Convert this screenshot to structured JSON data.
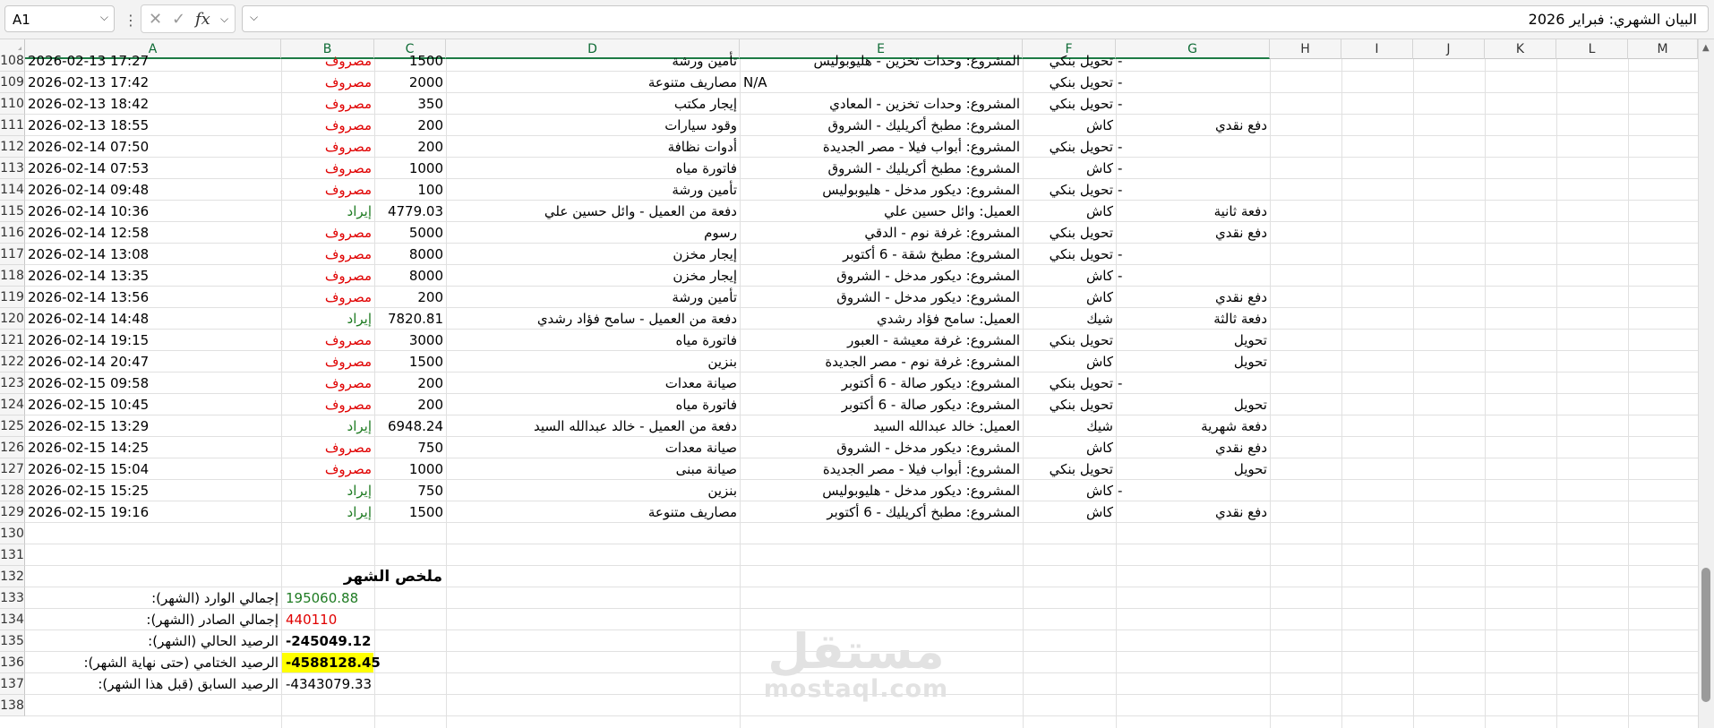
{
  "formula_bar": {
    "name_box": "A1",
    "separator": "⋮",
    "cancel_glyph": "✕",
    "enter_glyph": "✓",
    "fx_glyph": "fx",
    "content": "البيان الشهري: فبراير 2026"
  },
  "columns": [
    "A",
    "B",
    "C",
    "D",
    "E",
    "F",
    "G",
    "H",
    "I",
    "J",
    "K",
    "L",
    "M"
  ],
  "rows": [
    {
      "n": "108",
      "a": "2026-02-13 17:27",
      "b": "مصروف",
      "c": "1500",
      "d": "تأمين ورشة",
      "e": "المشروع: وحدات تخزين - هليوبوليس",
      "f": "تحويل بنكي",
      "g": "-",
      "h": "",
      "bclass": "red"
    },
    {
      "n": "109",
      "a": "2026-02-13 17:42",
      "b": "مصروف",
      "c": "2000",
      "d": "مصاريف متنوعة",
      "e": "N/A",
      "f": "تحويل بنكي",
      "g": "-",
      "h": "",
      "bclass": "red"
    },
    {
      "n": "110",
      "a": "2026-02-13 18:42",
      "b": "مصروف",
      "c": "350",
      "d": "إيجار مكتب",
      "e": "المشروع: وحدات تخزين - المعادي",
      "f": "تحويل بنكي",
      "g": "-",
      "h": "",
      "bclass": "red"
    },
    {
      "n": "111",
      "a": "2026-02-13 18:55",
      "b": "مصروف",
      "c": "200",
      "d": "وقود سيارات",
      "e": "المشروع: مطبخ أكريليك - الشروق",
      "f": "كاش",
      "g": "",
      "h": "دفع نقدي",
      "bclass": "red"
    },
    {
      "n": "112",
      "a": "2026-02-14 07:50",
      "b": "مصروف",
      "c": "200",
      "d": "أدوات نظافة",
      "e": "المشروع: أبواب فيلا - مصر الجديدة",
      "f": "تحويل بنكي",
      "g": "-",
      "h": "",
      "bclass": "red"
    },
    {
      "n": "113",
      "a": "2026-02-14 07:53",
      "b": "مصروف",
      "c": "1000",
      "d": "فاتورة مياه",
      "e": "المشروع: مطبخ أكريليك - الشروق",
      "f": "كاش",
      "g": "-",
      "h": "",
      "bclass": "red"
    },
    {
      "n": "114",
      "a": "2026-02-14 09:48",
      "b": "مصروف",
      "c": "100",
      "d": "تأمين ورشة",
      "e": "المشروع: ديكور مدخل - هليوبوليس",
      "f": "تحويل بنكي",
      "g": "-",
      "h": "",
      "bclass": "red"
    },
    {
      "n": "115",
      "a": "2026-02-14 10:36",
      "b": "إيراد",
      "c": "4779.03",
      "d": "دفعة من العميل - وائل حسين علي",
      "e": "العميل: وائل حسين علي",
      "f": "كاش",
      "g": "",
      "h": "دفعة ثانية",
      "bclass": "green"
    },
    {
      "n": "116",
      "a": "2026-02-14 12:58",
      "b": "مصروف",
      "c": "5000",
      "d": "رسوم",
      "e": "المشروع: غرفة نوم - الدقي",
      "f": "تحويل بنكي",
      "g": "",
      "h": "دفع نقدي",
      "bclass": "red"
    },
    {
      "n": "117",
      "a": "2026-02-14 13:08",
      "b": "مصروف",
      "c": "8000",
      "d": "إيجار مخزن",
      "e": "المشروع: مطبخ شقة - 6 أكتوبر",
      "f": "تحويل بنكي",
      "g": "-",
      "h": "",
      "bclass": "red"
    },
    {
      "n": "118",
      "a": "2026-02-14 13:35",
      "b": "مصروف",
      "c": "8000",
      "d": "إيجار مخزن",
      "e": "المشروع: ديكور مدخل - الشروق",
      "f": "كاش",
      "g": "-",
      "h": "",
      "bclass": "red"
    },
    {
      "n": "119",
      "a": "2026-02-14 13:56",
      "b": "مصروف",
      "c": "200",
      "d": "تأمين ورشة",
      "e": "المشروع: ديكور مدخل - الشروق",
      "f": "كاش",
      "g": "",
      "h": "دفع نقدي",
      "bclass": "red"
    },
    {
      "n": "120",
      "a": "2026-02-14 14:48",
      "b": "إيراد",
      "c": "7820.81",
      "d": "دفعة من العميل - سامح فؤاد رشدي",
      "e": "العميل: سامح فؤاد رشدي",
      "f": "شيك",
      "g": "",
      "h": "دفعة ثالثة",
      "bclass": "green"
    },
    {
      "n": "121",
      "a": "2026-02-14 19:15",
      "b": "مصروف",
      "c": "3000",
      "d": "فاتورة مياه",
      "e": "المشروع: غرفة معيشة - العبور",
      "f": "تحويل بنكي",
      "g": "",
      "h": "تحويل",
      "bclass": "red"
    },
    {
      "n": "122",
      "a": "2026-02-14 20:47",
      "b": "مصروف",
      "c": "1500",
      "d": "بنزين",
      "e": "المشروع: غرفة نوم - مصر الجديدة",
      "f": "كاش",
      "g": "",
      "h": "تحويل",
      "bclass": "red"
    },
    {
      "n": "123",
      "a": "2026-02-15 09:58",
      "b": "مصروف",
      "c": "200",
      "d": "صيانة معدات",
      "e": "المشروع: ديكور صالة - 6 أكتوبر",
      "f": "تحويل بنكي",
      "g": "-",
      "h": "",
      "bclass": "red"
    },
    {
      "n": "124",
      "a": "2026-02-15 10:45",
      "b": "مصروف",
      "c": "200",
      "d": "فاتورة مياه",
      "e": "المشروع: ديكور صالة - 6 أكتوبر",
      "f": "تحويل بنكي",
      "g": "",
      "h": "تحويل",
      "bclass": "red"
    },
    {
      "n": "125",
      "a": "2026-02-15 13:29",
      "b": "إيراد",
      "c": "6948.24",
      "d": "دفعة من العميل - خالد عبدالله السيد",
      "e": "العميل: خالد عبدالله السيد",
      "f": "شيك",
      "g": "",
      "h": "دفعة شهرية",
      "bclass": "green"
    },
    {
      "n": "126",
      "a": "2026-02-15 14:25",
      "b": "مصروف",
      "c": "750",
      "d": "صيانة معدات",
      "e": "المشروع: ديكور مدخل - الشروق",
      "f": "كاش",
      "g": "",
      "h": "دفع نقدي",
      "bclass": "red"
    },
    {
      "n": "127",
      "a": "2026-02-15 15:04",
      "b": "مصروف",
      "c": "1000",
      "d": "صيانة مبنى",
      "e": "المشروع: أبواب فيلا - مصر الجديدة",
      "f": "تحويل بنكي",
      "g": "",
      "h": "تحويل",
      "bclass": "red"
    },
    {
      "n": "128",
      "a": "2026-02-15 15:25",
      "b": "إيراد",
      "c": "750",
      "d": "بنزين",
      "e": "المشروع: ديكور مدخل - هليوبوليس",
      "f": "كاش",
      "g": "-",
      "h": "",
      "bclass": "green"
    },
    {
      "n": "129",
      "a": "2026-02-15 19:16",
      "b": "إيراد",
      "c": "1500",
      "d": "مصاريف متنوعة",
      "e": "المشروع: مطبخ أكريليك - 6 أكتوبر",
      "f": "كاش",
      "g": "",
      "h": "دفع نقدي",
      "bclass": "green"
    }
  ],
  "empty_rows": [
    "130",
    "131"
  ],
  "summary": {
    "rows": [
      "132",
      "133",
      "134",
      "135",
      "136",
      "137",
      "138"
    ],
    "title": "ملخص الشهر",
    "items": [
      {
        "label": "إجمالي الوارد (الشهر):",
        "value": "195060.88",
        "cls": "green"
      },
      {
        "label": "إجمالي الصادر (الشهر):",
        "value": "440110",
        "cls": "red"
      },
      {
        "label": "الرصيد الحالي (الشهر):",
        "value": "-245049.12",
        "cls": "bold"
      },
      {
        "label": "الرصيد الختامي (حتى نهاية الشهر):",
        "value": "-4588128.45",
        "cls": "bold hl"
      },
      {
        "label": "الرصيد السابق (قبل هذا الشهر):",
        "value": "-4343079.33",
        "cls": ""
      }
    ]
  },
  "watermark": {
    "arabic": "مستقل",
    "latin": "mostaql.com"
  },
  "colors": {
    "expense": "#e00000",
    "income": "#1e7b22",
    "highlight": "#ffff00"
  }
}
